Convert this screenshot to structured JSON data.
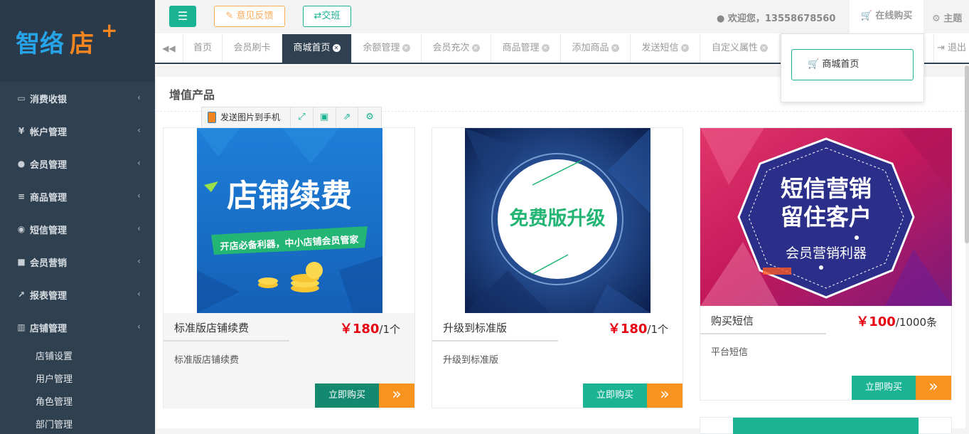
{
  "sidebar": {
    "logo": "智络店",
    "items": [
      {
        "label": "消费收银",
        "icon": "card-icon"
      },
      {
        "label": "帐户管理",
        "icon": "yen-icon"
      },
      {
        "label": "会员管理",
        "icon": "user-icon"
      },
      {
        "label": "商品管理",
        "icon": "database-icon"
      },
      {
        "label": "短信管理",
        "icon": "chat-icon"
      },
      {
        "label": "会员营销",
        "icon": "briefcase-icon"
      },
      {
        "label": "报表管理",
        "icon": "line-chart-icon"
      },
      {
        "label": "店铺管理",
        "icon": "bank-icon"
      }
    ],
    "subitems": [
      "店铺设置",
      "用户管理",
      "角色管理",
      "部门管理"
    ]
  },
  "topbar": {
    "feedback": "意见反馈",
    "shift": "交班",
    "welcome": "欢迎您，13558678560",
    "online_buy": "在线购买",
    "theme": "主题"
  },
  "tabs": {
    "items": [
      {
        "label": "首页",
        "closable": false
      },
      {
        "label": "会员刷卡",
        "closable": false
      },
      {
        "label": "商城首页",
        "closable": true,
        "active": true
      },
      {
        "label": "余额管理",
        "closable": true
      },
      {
        "label": "会员充次",
        "closable": true
      },
      {
        "label": "商品管理",
        "closable": true
      },
      {
        "label": "添加商品",
        "closable": true
      },
      {
        "label": "发送短信",
        "closable": true
      },
      {
        "label": "自定义属性",
        "closable": true
      }
    ],
    "exit": "退出"
  },
  "dropdown": {
    "item": "商城首页"
  },
  "main": {
    "title": "增值产品",
    "image_toolbar": {
      "send": "发送图片到手机"
    },
    "products": [
      {
        "image_title": "店铺续费",
        "image_sub": "开店必备利器，中小店铺会员管家",
        "name": "标准版店铺续费",
        "currency": "￥",
        "price": "180",
        "unit": "/1个",
        "desc": "标准版店铺续费",
        "buy": "立即购买"
      },
      {
        "image_title": "免费版升级",
        "name": "升级到标准版",
        "currency": "￥",
        "price": "180",
        "unit": "/1个",
        "desc": "升级到标准版",
        "buy": "立即购买"
      },
      {
        "image_title_1": "短信营销",
        "image_title_2": "留住客户",
        "image_sub": "会员营销利器",
        "name": "购买短信",
        "currency": "￥",
        "price": "100",
        "unit": "/1000条",
        "desc": "平台短信",
        "buy": "立即购买"
      }
    ]
  },
  "colors": {
    "sidebar": "#2f4050",
    "accent": "#1ab394",
    "warning": "#f8ac59",
    "price": "#e60012"
  }
}
